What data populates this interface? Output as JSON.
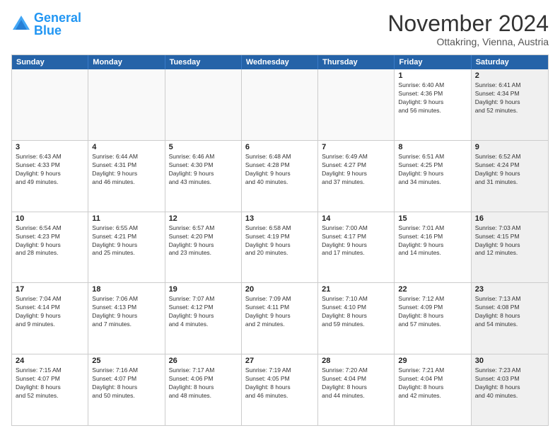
{
  "logo": {
    "text_general": "General",
    "text_blue": "Blue"
  },
  "title": "November 2024",
  "subtitle": "Ottakring, Vienna, Austria",
  "header_days": [
    "Sunday",
    "Monday",
    "Tuesday",
    "Wednesday",
    "Thursday",
    "Friday",
    "Saturday"
  ],
  "weeks": [
    {
      "cells": [
        {
          "day": "",
          "empty": true
        },
        {
          "day": "",
          "empty": true
        },
        {
          "day": "",
          "empty": true
        },
        {
          "day": "",
          "empty": true
        },
        {
          "day": "",
          "empty": true
        },
        {
          "day": "1",
          "lines": [
            "Sunrise: 6:40 AM",
            "Sunset: 4:36 PM",
            "Daylight: 9 hours",
            "and 56 minutes."
          ]
        },
        {
          "day": "2",
          "lines": [
            "Sunrise: 6:41 AM",
            "Sunset: 4:34 PM",
            "Daylight: 9 hours",
            "and 52 minutes."
          ],
          "shaded": true
        }
      ]
    },
    {
      "cells": [
        {
          "day": "3",
          "lines": [
            "Sunrise: 6:43 AM",
            "Sunset: 4:33 PM",
            "Daylight: 9 hours",
            "and 49 minutes."
          ]
        },
        {
          "day": "4",
          "lines": [
            "Sunrise: 6:44 AM",
            "Sunset: 4:31 PM",
            "Daylight: 9 hours",
            "and 46 minutes."
          ]
        },
        {
          "day": "5",
          "lines": [
            "Sunrise: 6:46 AM",
            "Sunset: 4:30 PM",
            "Daylight: 9 hours",
            "and 43 minutes."
          ]
        },
        {
          "day": "6",
          "lines": [
            "Sunrise: 6:48 AM",
            "Sunset: 4:28 PM",
            "Daylight: 9 hours",
            "and 40 minutes."
          ]
        },
        {
          "day": "7",
          "lines": [
            "Sunrise: 6:49 AM",
            "Sunset: 4:27 PM",
            "Daylight: 9 hours",
            "and 37 minutes."
          ]
        },
        {
          "day": "8",
          "lines": [
            "Sunrise: 6:51 AM",
            "Sunset: 4:25 PM",
            "Daylight: 9 hours",
            "and 34 minutes."
          ]
        },
        {
          "day": "9",
          "lines": [
            "Sunrise: 6:52 AM",
            "Sunset: 4:24 PM",
            "Daylight: 9 hours",
            "and 31 minutes."
          ],
          "shaded": true
        }
      ]
    },
    {
      "cells": [
        {
          "day": "10",
          "lines": [
            "Sunrise: 6:54 AM",
            "Sunset: 4:23 PM",
            "Daylight: 9 hours",
            "and 28 minutes."
          ]
        },
        {
          "day": "11",
          "lines": [
            "Sunrise: 6:55 AM",
            "Sunset: 4:21 PM",
            "Daylight: 9 hours",
            "and 25 minutes."
          ]
        },
        {
          "day": "12",
          "lines": [
            "Sunrise: 6:57 AM",
            "Sunset: 4:20 PM",
            "Daylight: 9 hours",
            "and 23 minutes."
          ]
        },
        {
          "day": "13",
          "lines": [
            "Sunrise: 6:58 AM",
            "Sunset: 4:19 PM",
            "Daylight: 9 hours",
            "and 20 minutes."
          ]
        },
        {
          "day": "14",
          "lines": [
            "Sunrise: 7:00 AM",
            "Sunset: 4:17 PM",
            "Daylight: 9 hours",
            "and 17 minutes."
          ]
        },
        {
          "day": "15",
          "lines": [
            "Sunrise: 7:01 AM",
            "Sunset: 4:16 PM",
            "Daylight: 9 hours",
            "and 14 minutes."
          ]
        },
        {
          "day": "16",
          "lines": [
            "Sunrise: 7:03 AM",
            "Sunset: 4:15 PM",
            "Daylight: 9 hours",
            "and 12 minutes."
          ],
          "shaded": true
        }
      ]
    },
    {
      "cells": [
        {
          "day": "17",
          "lines": [
            "Sunrise: 7:04 AM",
            "Sunset: 4:14 PM",
            "Daylight: 9 hours",
            "and 9 minutes."
          ]
        },
        {
          "day": "18",
          "lines": [
            "Sunrise: 7:06 AM",
            "Sunset: 4:13 PM",
            "Daylight: 9 hours",
            "and 7 minutes."
          ]
        },
        {
          "day": "19",
          "lines": [
            "Sunrise: 7:07 AM",
            "Sunset: 4:12 PM",
            "Daylight: 9 hours",
            "and 4 minutes."
          ]
        },
        {
          "day": "20",
          "lines": [
            "Sunrise: 7:09 AM",
            "Sunset: 4:11 PM",
            "Daylight: 9 hours",
            "and 2 minutes."
          ]
        },
        {
          "day": "21",
          "lines": [
            "Sunrise: 7:10 AM",
            "Sunset: 4:10 PM",
            "Daylight: 8 hours",
            "and 59 minutes."
          ]
        },
        {
          "day": "22",
          "lines": [
            "Sunrise: 7:12 AM",
            "Sunset: 4:09 PM",
            "Daylight: 8 hours",
            "and 57 minutes."
          ]
        },
        {
          "day": "23",
          "lines": [
            "Sunrise: 7:13 AM",
            "Sunset: 4:08 PM",
            "Daylight: 8 hours",
            "and 54 minutes."
          ],
          "shaded": true
        }
      ]
    },
    {
      "cells": [
        {
          "day": "24",
          "lines": [
            "Sunrise: 7:15 AM",
            "Sunset: 4:07 PM",
            "Daylight: 8 hours",
            "and 52 minutes."
          ]
        },
        {
          "day": "25",
          "lines": [
            "Sunrise: 7:16 AM",
            "Sunset: 4:07 PM",
            "Daylight: 8 hours",
            "and 50 minutes."
          ]
        },
        {
          "day": "26",
          "lines": [
            "Sunrise: 7:17 AM",
            "Sunset: 4:06 PM",
            "Daylight: 8 hours",
            "and 48 minutes."
          ]
        },
        {
          "day": "27",
          "lines": [
            "Sunrise: 7:19 AM",
            "Sunset: 4:05 PM",
            "Daylight: 8 hours",
            "and 46 minutes."
          ]
        },
        {
          "day": "28",
          "lines": [
            "Sunrise: 7:20 AM",
            "Sunset: 4:04 PM",
            "Daylight: 8 hours",
            "and 44 minutes."
          ]
        },
        {
          "day": "29",
          "lines": [
            "Sunrise: 7:21 AM",
            "Sunset: 4:04 PM",
            "Daylight: 8 hours",
            "and 42 minutes."
          ]
        },
        {
          "day": "30",
          "lines": [
            "Sunrise: 7:23 AM",
            "Sunset: 4:03 PM",
            "Daylight: 8 hours",
            "and 40 minutes."
          ],
          "shaded": true
        }
      ]
    }
  ]
}
